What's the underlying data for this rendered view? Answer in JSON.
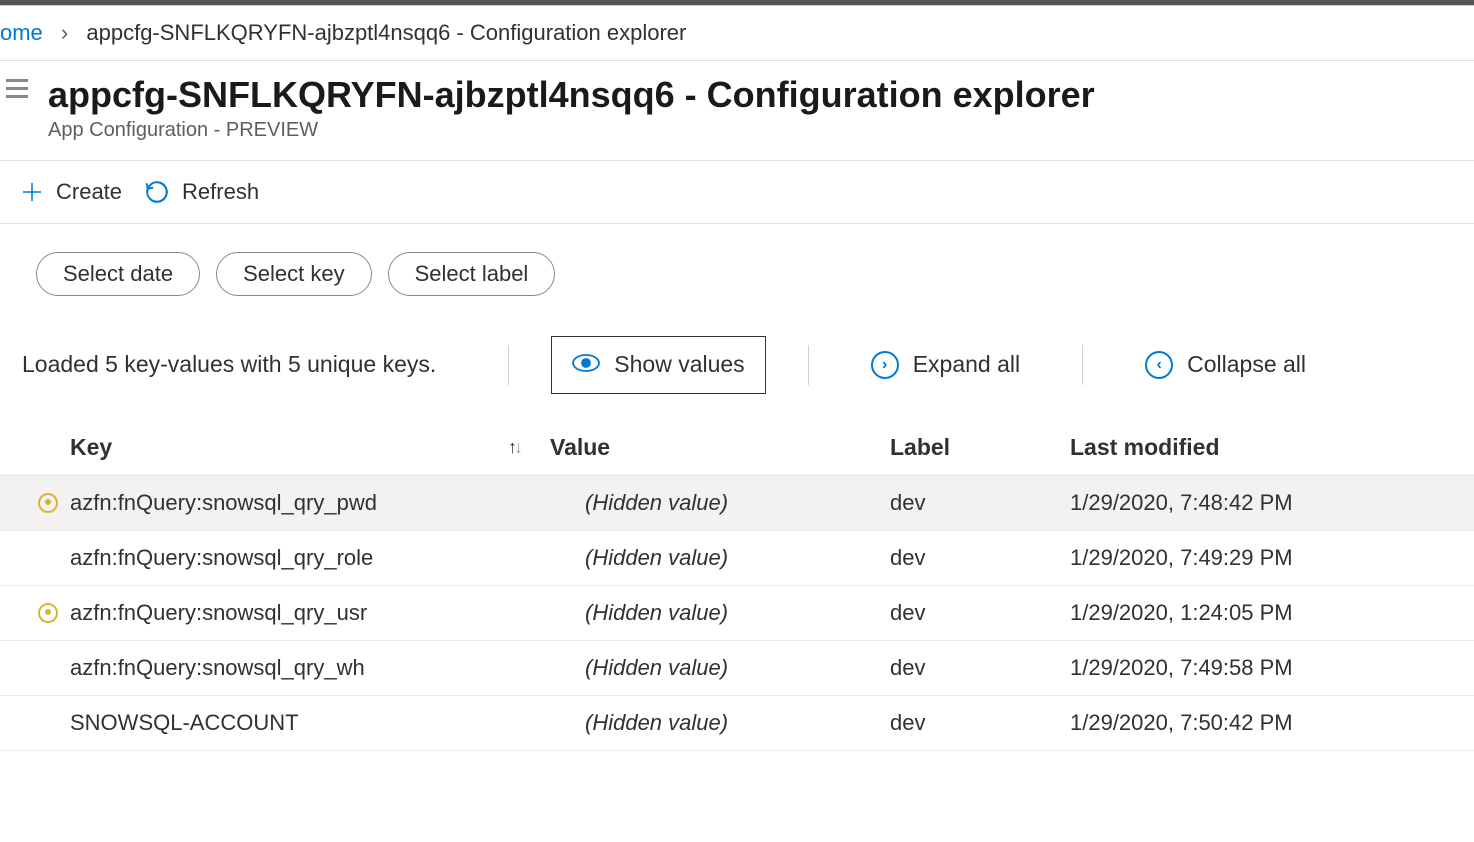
{
  "breadcrumb": {
    "home": "ome",
    "current": "appcfg-SNFLKQRYFN-ajbzptl4nsqq6 - Configuration explorer"
  },
  "header": {
    "title": "appcfg-SNFLKQRYFN-ajbzptl4nsqq6 - Configuration explorer",
    "subtitle": "App Configuration - PREVIEW"
  },
  "toolbar": {
    "create": "Create",
    "refresh": "Refresh"
  },
  "filters": {
    "date": "Select date",
    "key": "Select key",
    "label": "Select label"
  },
  "status": "Loaded 5 key-values with 5 unique keys.",
  "actions": {
    "show_values": "Show values",
    "expand_all": "Expand all",
    "collapse_all": "Collapse all"
  },
  "columns": {
    "key": "Key",
    "value": "Value",
    "label": "Label",
    "modified": "Last modified"
  },
  "rows": [
    {
      "icon": true,
      "key": "azfn:fnQuery:snowsql_qry_pwd",
      "value": "(Hidden value)",
      "label": "dev",
      "modified": "1/29/2020, 7:48:42 PM",
      "selected": true
    },
    {
      "icon": false,
      "key": "azfn:fnQuery:snowsql_qry_role",
      "value": "(Hidden value)",
      "label": "dev",
      "modified": "1/29/2020, 7:49:29 PM",
      "selected": false
    },
    {
      "icon": true,
      "key": "azfn:fnQuery:snowsql_qry_usr",
      "value": "(Hidden value)",
      "label": "dev",
      "modified": "1/29/2020, 1:24:05 PM",
      "selected": false
    },
    {
      "icon": false,
      "key": "azfn:fnQuery:snowsql_qry_wh",
      "value": "(Hidden value)",
      "label": "dev",
      "modified": "1/29/2020, 7:49:58 PM",
      "selected": false
    },
    {
      "icon": false,
      "key": "SNOWSQL-ACCOUNT",
      "value": "(Hidden value)",
      "label": "dev",
      "modified": "1/29/2020, 7:50:42 PM",
      "selected": false
    }
  ]
}
